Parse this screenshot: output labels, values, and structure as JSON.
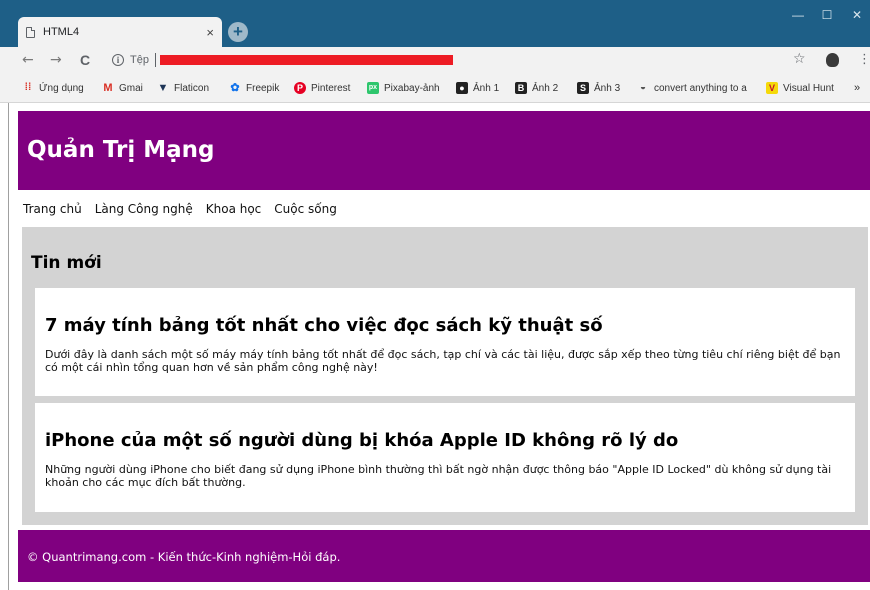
{
  "browser": {
    "tab_title": "HTML4",
    "tab_close": "×",
    "new_tab": "+",
    "window_controls": {
      "minimize": "—",
      "maximize": "☐",
      "close": "✕"
    },
    "nav": {
      "back": "←",
      "forward": "→",
      "reload": "C"
    },
    "omnibox": {
      "info_icon": "i",
      "label": "Tệp",
      "redacted_color": "#ed1c24"
    },
    "star": "☆",
    "menu": "⋮",
    "bookmarks": [
      {
        "label": "Ứng dụng",
        "icon": "apps-grid-icon"
      },
      {
        "label": "Gmai",
        "icon": "gmail-icon"
      },
      {
        "label": "Flaticon",
        "icon": "flaticon-icon"
      },
      {
        "label": "Freepik",
        "icon": "freepik-icon"
      },
      {
        "label": "Pinterest",
        "icon": "pinterest-icon"
      },
      {
        "label": "Pixabay-ảnh",
        "icon": "pixabay-icon"
      },
      {
        "label": "Ảnh 1",
        "icon": "camera-icon"
      },
      {
        "label": "Ảnh 2",
        "icon": "b-icon"
      },
      {
        "label": "Ảnh 3",
        "icon": "s-icon"
      },
      {
        "label": "convert anything to a",
        "icon": "gauge-icon"
      },
      {
        "label": "Visual Hunt",
        "icon": "v-icon"
      }
    ],
    "bookmarks_more": "»"
  },
  "site": {
    "title": "Quản Trị Mạng",
    "brand_color": "#800080",
    "menu": [
      "Trang chủ",
      "Làng Công nghệ",
      "Khoa học",
      "Cuộc sống"
    ],
    "section_title": "Tin mới",
    "articles": [
      {
        "title": "7 máy tính bảng tốt nhất cho việc đọc sách kỹ thuật số",
        "summary": "Dưới đây là danh sách một số máy máy tính bảng tốt nhất để đọc sách, tạp chí và các tài liệu, được sắp xếp theo từng tiêu chí riêng biệt để bạn có một cái nhìn tổng quan hơn về sản phẩm công nghệ này!"
      },
      {
        "title": "iPhone của một số người dùng bị khóa Apple ID không rõ lý do",
        "summary": "Những người dùng iPhone cho biết đang sử dụng iPhone bình thường thì bất ngờ nhận được thông báo \"Apple ID Locked\" dù không sử dụng tài khoản cho các mục đích bất thường."
      }
    ],
    "footer": "© Quantrimang.com - Kiến thức-Kinh nghiệm-Hỏi đáp."
  }
}
